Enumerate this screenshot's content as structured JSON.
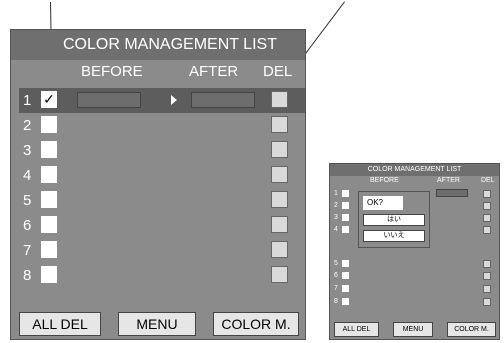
{
  "main": {
    "title": "COLOR MANAGEMENT LIST",
    "headers": {
      "before": "BEFORE",
      "after": "AFTER",
      "del": "DEL"
    },
    "rows": [
      {
        "num": "1",
        "check": "✓"
      },
      {
        "num": "2",
        "check": ""
      },
      {
        "num": "3",
        "check": ""
      },
      {
        "num": "4",
        "check": ""
      },
      {
        "num": "5",
        "check": ""
      },
      {
        "num": "6",
        "check": ""
      },
      {
        "num": "7",
        "check": ""
      },
      {
        "num": "8",
        "check": ""
      }
    ],
    "buttons": {
      "all_del": "ALL DEL",
      "menu": "MENU",
      "color_m": "COLOR M."
    }
  },
  "small": {
    "title": "COLOR MANAGEMENT LIST",
    "headers": {
      "before": "BEFORE",
      "after": "AFTER",
      "del": "DEL"
    },
    "rows": [
      "1",
      "2",
      "3",
      "4",
      "5",
      "6",
      "7",
      "8"
    ],
    "dialog": {
      "prompt": "OK?",
      "yes": "はい",
      "no": "いいえ"
    },
    "buttons": {
      "all_del": "ALL DEL",
      "menu": "MENU",
      "color_m": "COLOR M."
    }
  }
}
